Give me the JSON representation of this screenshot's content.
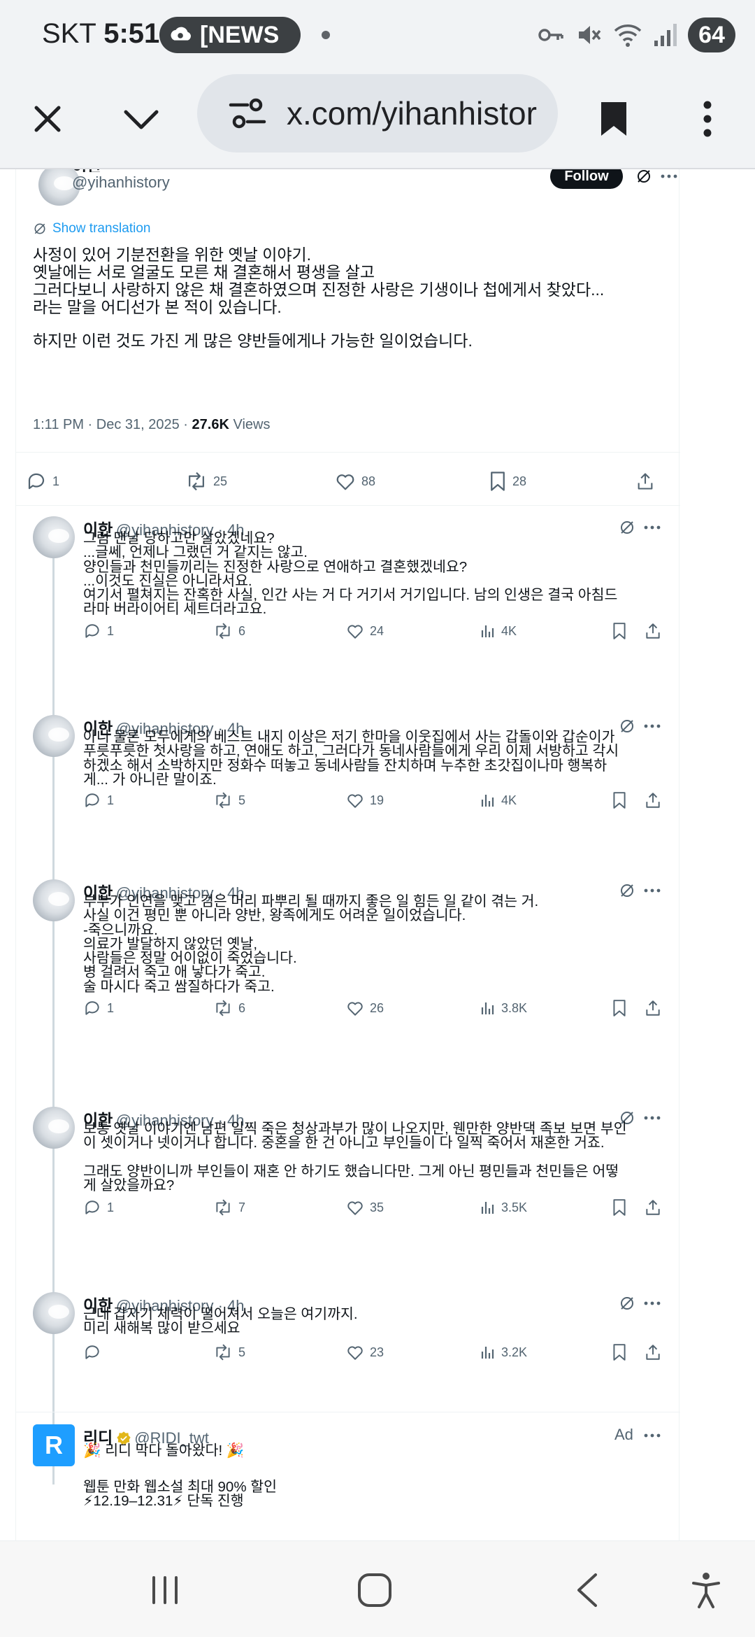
{
  "status_bar": {
    "carrier": "SKT",
    "time": "5:51",
    "news_pill": "[NEWS",
    "battery": "64",
    "icons": [
      "cloud-notification-icon",
      "vpn-key-icon",
      "mute-icon",
      "wifi-icon",
      "signal-icon"
    ]
  },
  "browser": {
    "url": "x.com/yihanhistor",
    "icons": [
      "close-icon",
      "chevron-down-icon",
      "tune-icon",
      "bookmark-icon",
      "more-vertical-icon"
    ]
  },
  "main_tweet": {
    "name": "이한",
    "handle": "@yihanhistory",
    "follow_label": "Follow",
    "show_translation": "Show translation",
    "text_lines": [
      "사정이 있어 기분전환을 위한 옛날 이야기.",
      "옛날에는 서로 얼굴도 모른 채 결혼해서 평생을 살고",
      "그러다보니 사랑하지 않은 채 결혼하였으며 진정한 사랑은 기생이나 첩에게서 찾았다...",
      "라는 말을 어디선가 본 적이 있습니다.",
      "",
      "하지만 이런 것도 가진 게 많은 양반들에게나 가능한 일이었습니다."
    ],
    "timestamp": "1:11 PM · Dec 31, 2025 · ",
    "views_count": "27.6K",
    "views_label": " Views",
    "replies": "1",
    "reposts": "25",
    "likes": "88",
    "bookmarks": "28"
  },
  "replies": [
    {
      "name": "이한",
      "handle": "@yihanhistory · 4h",
      "lines": [
        "그럼 맨날 당하고만 살았겠네요?",
        "...글쎄, 언제나 그랬던 거 같지는 않고.",
        "양인들과 천민들끼리는 진정한 사랑으로 연애하고 결혼했겠네요?",
        "...이것도 진실은 아니라서요.",
        "여기서 펼쳐지는 잔혹한 사실, 인간 사는 거 다 거기서 거기입니다. 남의 인생은 결국 아침드",
        "라마 버라이어티 세트더라고요."
      ],
      "replies": "1",
      "reposts": "6",
      "likes": "24",
      "views": "4K"
    },
    {
      "name": "이한",
      "handle": "@yihanhistory · 4h",
      "lines": [
        "아니 물론 모두에게의 베스트 내지 이상은 저기 한마을 이웃집에서 사는 갑돌이와 갑순이가",
        "푸릇푸릇한 첫사랑을 하고, 연애도 하고, 그러다가 동네사람들에게 우리 이제 서방하고 각시",
        "하겠소 해서 소박하지만 정화수 떠놓고 동네사람들 잔치하며 누추한 초갓집이나마 행복하",
        "게... 가 아니란 말이죠."
      ],
      "replies": "1",
      "reposts": "5",
      "likes": "19",
      "views": "4K"
    },
    {
      "name": "이한",
      "handle": "@yihanhistory · 4h",
      "lines": [
        "부부가 인연을 맺고 검은 머리 파뿌리 될 때까지 좋은 일 힘든 일 같이 겪는 거.",
        "사실 이건 평민 뿐 아니라 양반, 왕족에게도 어려운 일이었습니다.",
        "-죽으니까요.",
        "의료가 발달하지 않았던 옛날,",
        "사람들은 정말 어이없이 죽었습니다.",
        "병 걸려서 죽고 애 낳다가 죽고.",
        "술 마시다 죽고 쌈질하다가 죽고."
      ],
      "replies": "1",
      "reposts": "6",
      "likes": "26",
      "views": "3.8K"
    },
    {
      "name": "이한",
      "handle": "@yihanhistory · 4h",
      "lines": [
        "보통 옛날 이야기엔 남편 일찍 죽은 청상과부가 많이 나오지만, 웬만한 양반댁 족보 보면 부인",
        "이 셋이거나 넷이거나 합니다. 중혼을 한 건 아니고 부인들이 다 일찍 죽어서 재혼한 거죠.",
        "",
        "그래도 양반이니까 부인들이 재혼 안 하기도 했습니다만. 그게 아닌 평민들과 천민들은 어떻",
        "게 살았을까요?"
      ],
      "replies": "1",
      "reposts": "7",
      "likes": "35",
      "views": "3.5K"
    },
    {
      "name": "이한",
      "handle": "@yihanhistory · 4h",
      "lines": [
        "근데 갑자기 체력이 떨어져서 오늘은 여기까지.",
        "미리 새해복 많이 받으세요"
      ],
      "replies": "",
      "reposts": "5",
      "likes": "23",
      "views": "3.2K"
    }
  ],
  "ad": {
    "avatar_letter": "R",
    "name": "리디",
    "handle": "@RIDI_twt",
    "badge": "Ad",
    "lines": [
      "🎉 리디 막다 돌아왔다! 🎉",
      "",
      "웹툰 만화 웹소설 최대 90% 할인",
      "⚡12.19–12.31⚡ 단독 진행"
    ]
  },
  "nav_bar": {
    "icons": [
      "recent-apps-icon",
      "home-icon",
      "back-icon",
      "accessibility-icon"
    ]
  },
  "colors": {
    "status_bg": "#f1f3f5",
    "url_bg": "#e1e5ea",
    "text": "#0f1419",
    "muted": "#536471",
    "link": "#1d9bf0",
    "thread_line": "#cfd9de",
    "ridi_blue": "#1e9eff"
  }
}
